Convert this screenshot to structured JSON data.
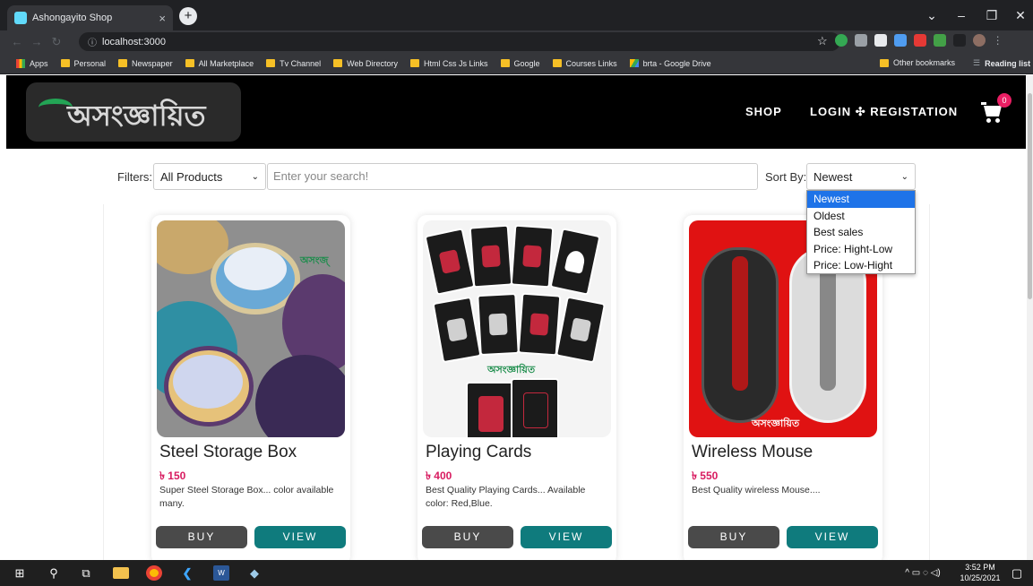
{
  "browser": {
    "tab_title": "Ashongayito Shop",
    "tab_close": "×",
    "new_tab": "+",
    "address": "localhost:3000",
    "bookmarks": [
      "Apps",
      "Personal",
      "Newspaper",
      "All Marketplace",
      "Tv Channel",
      "Web Directory",
      "Html Css Js Links",
      "Google",
      "Courses Links",
      "brta - Google Drive"
    ],
    "other_bookmarks": "Other bookmarks",
    "reading_list": "Reading list"
  },
  "site": {
    "logo_text": "অসংজ্ঞায়িত",
    "nav": {
      "shop": "SHOP",
      "login": "LOGIN ✣ REGISTATION"
    },
    "cart_count": "0"
  },
  "toolbar": {
    "filters_label": "Filters:",
    "filter_value": "All Products",
    "search_placeholder": "Enter your search!",
    "sort_label": "Sort By:",
    "sort_value": "Newest",
    "sort_options": [
      "Newest",
      "Oldest",
      "Best sales",
      "Price: Hight-Low",
      "Price: Low-Hight"
    ]
  },
  "products": [
    {
      "name": "Steel Storage Box",
      "price": "৳ 150",
      "description": "Super Steel Storage Box... color available many.",
      "buy": "BUY",
      "view": "VIEW"
    },
    {
      "name": "Playing Cards",
      "price": "৳ 400",
      "description": "Best Quality Playing Cards... Available color: Red,Blue.",
      "buy": "BUY",
      "view": "VIEW"
    },
    {
      "name": "Wireless Mouse",
      "price": "৳ 550",
      "description": "Best Quality wireless Mouse....",
      "buy": "BUY",
      "view": "VIEW"
    }
  ],
  "taskbar": {
    "time": "3:52 PM",
    "date": "10/25/2021"
  },
  "colors": {
    "header_bg": "#000000",
    "price": "#d81b60",
    "buy_btn": "#4a4a4a",
    "view_btn": "#0f7b7d",
    "selected_option": "#1e73e8"
  }
}
